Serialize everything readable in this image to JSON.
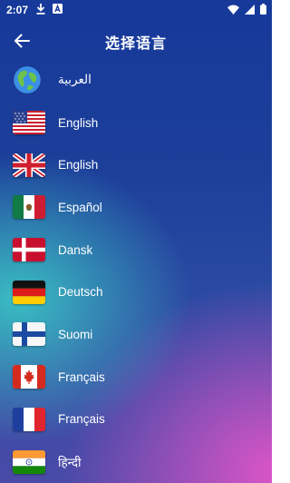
{
  "status_bar": {
    "time": "2:07",
    "left_icons": [
      "download-icon",
      "text-a-icon"
    ],
    "right_icons": [
      "wifi-icon",
      "signal-icon",
      "battery-icon"
    ]
  },
  "header": {
    "title": "选择语言",
    "back_icon": "arrow-left-icon"
  },
  "languages": [
    {
      "label": "العربية",
      "flag": "globe"
    },
    {
      "label": "English",
      "flag": "us"
    },
    {
      "label": "English",
      "flag": "uk"
    },
    {
      "label": "Español",
      "flag": "mexico"
    },
    {
      "label": "Dansk",
      "flag": "denmark"
    },
    {
      "label": "Deutsch",
      "flag": "germany"
    },
    {
      "label": "Suomi",
      "flag": "finland"
    },
    {
      "label": "Français",
      "flag": "canada"
    },
    {
      "label": "Français",
      "flag": "france"
    },
    {
      "label": "हिन्दी",
      "flag": "india"
    }
  ],
  "colors": {
    "background_top": "#16399a",
    "background_teal": "#3cd2c8",
    "background_magenta": "#e155c8",
    "text": "#ffffff"
  }
}
